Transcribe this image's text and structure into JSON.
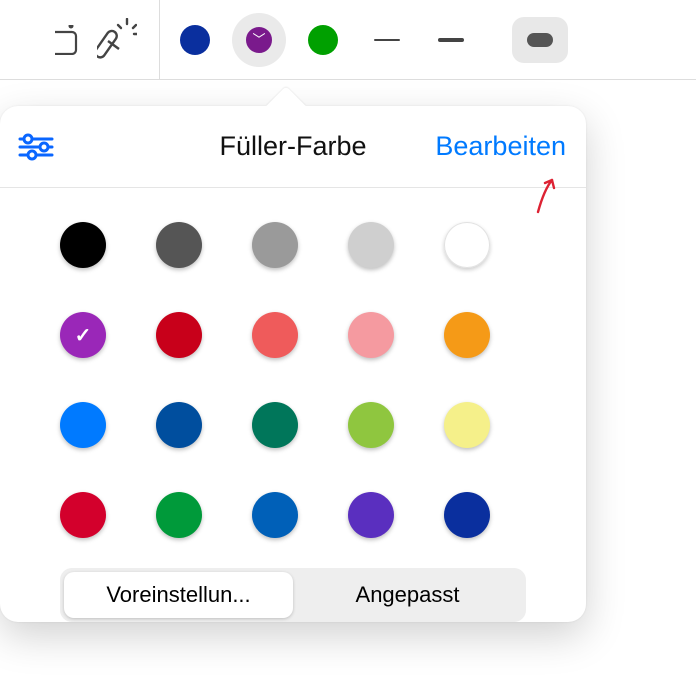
{
  "toolbar": {
    "swatches": [
      {
        "name": "blue",
        "color": "#0a2f9e",
        "selected": false
      },
      {
        "name": "purple",
        "color": "#7a1a8c",
        "selected": true
      },
      {
        "name": "green",
        "color": "#00a000",
        "selected": false
      }
    ]
  },
  "popover": {
    "title": "Füller-Farbe",
    "edit_label": "Bearbeiten",
    "swatches": [
      {
        "name": "black",
        "color": "#000000"
      },
      {
        "name": "dark-gray",
        "color": "#555555"
      },
      {
        "name": "gray",
        "color": "#9a9a9a"
      },
      {
        "name": "light-gray",
        "color": "#cfcfcf"
      },
      {
        "name": "white",
        "color": "#ffffff",
        "white": true
      },
      {
        "name": "purple",
        "color": "#9a27b8",
        "selected": true
      },
      {
        "name": "red",
        "color": "#c8001a"
      },
      {
        "name": "coral",
        "color": "#ef5b5b"
      },
      {
        "name": "pink",
        "color": "#f59aa0"
      },
      {
        "name": "orange",
        "color": "#f59a17"
      },
      {
        "name": "blue",
        "color": "#007aff"
      },
      {
        "name": "dark-blue",
        "color": "#004e9e"
      },
      {
        "name": "teal",
        "color": "#00765a"
      },
      {
        "name": "lime",
        "color": "#8fc63f"
      },
      {
        "name": "yellow",
        "color": "#f5f08a"
      },
      {
        "name": "crimson",
        "color": "#d3002c"
      },
      {
        "name": "green",
        "color": "#009a3a"
      },
      {
        "name": "royal-blue",
        "color": "#0060b8"
      },
      {
        "name": "violet",
        "color": "#5a2fbf"
      },
      {
        "name": "navy",
        "color": "#0a2f9e"
      }
    ],
    "segments": {
      "preset_label": "Voreinstellun...",
      "custom_label": "Angepasst",
      "active": "preset"
    }
  }
}
